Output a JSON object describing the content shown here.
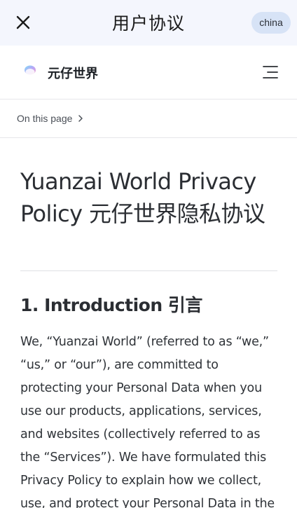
{
  "topbar": {
    "title": "用户协议",
    "region_badge": "china"
  },
  "site_header": {
    "brand_name": "元仔世界"
  },
  "toc": {
    "label": "On this page"
  },
  "article": {
    "title": "Yuanzai World Privacy Policy 元仔世界隐私协议",
    "section_title": "1. Introduction 引言",
    "paragraph": "We, “Yuanzai World” (referred to as “we,” “us,” or “our”), are committed to protecting your Personal Data when you use our products, applications, services, and websites (collectively referred to as the “Services”). We have formulated this Privacy Policy to explain how we collect, use, and protect your Personal Data in the"
  },
  "colors": {
    "topbar_bg": "#f4f6fd",
    "badge_bg": "#d7e3f6",
    "text": "#2b2e33",
    "divider": "#dfe1e5"
  },
  "icons": {
    "close": "close-icon",
    "logo": "logo-icon",
    "menu": "menu-icon",
    "chevron": "chevron-right-icon"
  }
}
